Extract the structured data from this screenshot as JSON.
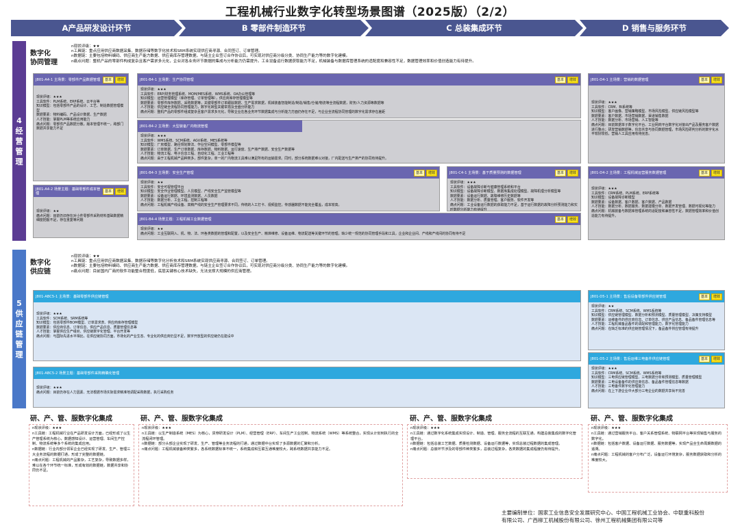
{
  "title": "工程机械行业数字化转型场景图谱（2025版）（2/2）",
  "stages": [
    "A产品研发设计环节",
    "B 零部件制造环节",
    "C 总装集成环节",
    "D 销售与服务环节"
  ],
  "colors": {
    "stage": "#4a5690",
    "management": "#5b3c93",
    "supply": "#4a78c8",
    "header_purple": "#6a66b0",
    "header_cyan": "#2ea8de",
    "card_gray": "#cfcfd3",
    "card_blue": "#dbe6f4",
    "tag_yellow": "#f7e01c"
  },
  "row1": {
    "sidebar": "4经营管理",
    "section_label_1": "数字化",
    "section_label_2": "协同管理",
    "lines": [
      "n现状评级：★★",
      "n工具链：重点应用供应商数据采集、数据存储等数字化技术和SRM系统实现供应商寻源、合同签订、订单管理。",
      "n数据链：主要包括物料编码、供应商生产能力数据、供应商库存管理数据，与链主企业签订合作协议后，可实现对供应商分级分类、协同生产能力等的数字化建模。",
      "n痛点问题：整机产品的零部件构成复杂且客户需求多元化，企业对各业务环节数据的集成与分析能力仍需提升。工业设备运行数据获取能力不足，机械装备与数据库管理系统的适配度和兼容性不足，数据管理效率和价值创造能力有待提升。"
    ],
    "cards": {
      "a1": {
        "head": "J801-A4-1 主场景：零部件产品数据管理",
        "tags": [
          "基本",
          "增效"
        ],
        "body": [
          "现状评级：★★★",
          "工具软件：PLM系统、ERP系统、云平台等",
          "知识模型：包括零部件产品的设计、工艺、制造数据管理模型",
          "数据要素：物料编码、产品设计数据、生产数据",
          "人才技能：掌握PLM等系统应用能力",
          "痛点问题：零部件产品数据分散，版本管理不统一，跨部门数据共享能力不足"
        ]
      },
      "a2": {
        "head": "J801-A4-2 场景主题：基础零部件成本管理",
        "tags": [
          "基本",
          "增效"
        ],
        "body": [
          "现状评级：★★",
          "痛点问题：目前仍旧存在对小件零部件采购材料基础数据精细度把握不足，存在重复等问题"
        ]
      },
      "b1": {
        "head": "J801-B4-1 主场景：生产协同管理",
        "tags": [
          "基本",
          "增效"
        ],
        "body": [
          "现状评级：★★★",
          "工具软件：ERP/财务管理系统、MOM/MES系统、WMS系统、OA办公管理等",
          "知识模型：运营管理模型（库存管理、订单管理等），供应商库存管理模型等",
          "数据要素：零部件库存数据、采购数据等，关键零部件订单跟踪数据、生产需求数据，机械装备智能制造/制造/销售/仓储/物流等全流程数据，财务/人力资源等数据等",
          "人才技能：供应链全流程协同管理能力，数字化转型关键举措及全面分析能力",
          "痛点问题：整机产品的零部件组成复杂且客户需求多元化，导致企业在各业务环节数据集成与分析能力方面仍存在不足，与企业全流程协同管理的数字化需求存在差距"
        ]
      },
      "b2": {
        "head": "J801-B4-2 主场景：大型装备厂内物流管理",
        "tags": [],
        "body": [
          "现状评级：★★★",
          "工具软件：WMS系统、SCM系统、AGV系统、MES系统等",
          "知识模型：厂房模型、路径规划算法、作业空间模型、零部件模型等",
          "数据要素：订单数据、生产订单数据、库存数据、物料数据、运行速度、生产排产数据、安全生产数据等",
          "人才技能：物流工程、电子信息工程、自动化工程、工业工程等",
          "痛点问题：由于工程机械产品种类多，部件复杂，单一的厂内物流工具难以满足所有的运输需求。同时，部分系统数据难以对接，厂内配送与生产排产的协同有待提升。"
        ]
      },
      "b3": {
        "head": "J801-B4-3 主场景：安全生产管理",
        "tags": [
          "基本",
          "增效"
        ],
        "body": [
          "现状评级：★★",
          "工具软件：安全可视管理平台",
          "知识模型：安全作业管理模型、人员模型、产线安全生产监管模型等",
          "数据要素：设备运行数据、环境监测数据、人员数据",
          "人才技能：数据分析、工业工程、控制工程等",
          "痛点问题：工程机械产线设备、高精产线的安全生产管理要求不同，传统的人工打卡、视频监控，传感器数据不能完全覆盖，成本较高。"
        ]
      },
      "b4": {
        "head": "J801-B4-4 场景主题：工程机械工业数据管理",
        "tags": [
          "基本",
          "增效"
        ],
        "body": [
          "现状评级：★★",
          "痛点问题：工业互联网入、机、物、法、环各类数据的管理和配置，以及安全生产、精准维修、设备运维、物流配送等关键环节的管理，缺少统一规范的协同管理手段和工具，企业和企业间、产线和产线间的协同有待不足"
        ]
      },
      "c1": {
        "head": "J801-C4-1 主场景：基于质量预测的数据管理",
        "tags": [
          "基本",
          "增效"
        ],
        "body": [
          "现状评级：★★★",
          "工具软件：设备故障诊断与健康管理系统和平台",
          "知识模型：设备故障诊断模型、数据库集成处理模型、故障机理分析模型等",
          "数据要素：设备运行数据、故障维修历史数据等",
          "人才技能：数据分析、质量管理、客户服务、软件开发等",
          "痛点问题：工业设备运行数据的获取能力不足，基于运行数据的故障分析预测能力和实时数据分析能力有待提升"
        ]
      },
      "d1": {
        "head": "J801-D4-1 主场景：营销的数据管理",
        "tags": [
          "基本",
          "增效"
        ],
        "body": [
          "现状评级：★★★",
          "工具软件：CRM、BI系统等",
          "知识模型：客户画像、营销策略模型、市场风险模型、供应链风险模型等",
          "数据要素：客户数据、市场营销数据、渠道销售数据",
          "人才技能：数据分析、市场营销、人工智能等",
          "痛点问题：目前数据单子数字化平台、工业网商平台数字化对接出产品及服务客户数据进行整合；研发营销数据等，信息共享与协同数据管理，市场风险研判分析的数字化水平较好较低，营销人工具应用有待完善。"
        ]
      },
      "d2": {
        "head": "J801-D4-2 主场景：工程机械运营服务数据管理",
        "tags": [
          "基本",
          "增效"
        ],
        "body": [
          "现状评级：★★★",
          "工具软件：CRM系统、PLM系统、ERP系统等",
          "知识模型：设备故障诊断模型",
          "数据要素：设备数据、客户数据、客户数据、产品数据",
          "人才技能：数据分析、数据服务、数据建模分析、数据开发管理、数据可视化等能力",
          "痛点问题：机械装备与数据库管理系统的适配度和兼容性不足，数据管理效率和价值创造能力有待提升。"
        ]
      }
    }
  },
  "row2": {
    "sidebar": "5供应链管理",
    "section_label_1": "数字化",
    "section_label_2": "供应链",
    "lines": [
      "n现状评级：★★",
      "n工具链：重点应用供应商数据采集、数据存储等数字化分析技术和SRM系统实现供应商寻源、合同签订、订单管理。",
      "n数据链：主要包括物料编码、供应商生产能力数据、供应商库存管理数据，与链主企业签订合作协议后，可实现对供应商分级分类、协同生产能力等的数字化建模。",
      "n痛点问题：目前国内厂商的软件功能整合程度低，底层关键核心技术缺失，无法支撑大规模的供应商管理。"
    ],
    "cards": {
      "abc1": {
        "head": "J801-ABC5-1 主场景：基础零部件供应链管理",
        "tags": [],
        "body": [
          "现状评级：★★★",
          "工具软件：SCM系统、SRM系统等",
          "知识模型：包括零部件BOM模型、订单需求表、供应商库存管理模型",
          "数据要素：供应商信息、订单信息、供应产品信息、质量管理信息等",
          "人才技能：掌握供应生产组织、供应链数字化管理、平台开发等",
          "痛点问题：与国际先进水平相比，在供应链协同方面，市场化的产业生态、专业化的供应商仍显不足，数字开放型的供应链仍在建设中"
        ]
      },
      "abc2": {
        "head": "J801-ABC5-2 场景主题：基础零部件采购精确化管理",
        "tags": [],
        "body": [
          "现状评级：★★★",
          "痛点问题：目前仍存在人力因素、无法根据市场实际需求精准地调配采购数据，执行采购任务"
        ]
      },
      "d1": {
        "head": "J801-D5-1 主场景：售后设备零部件供应链管理",
        "tags": [
          "基本",
          "增效"
        ],
        "body": [
          "现状评级：★★",
          "工具软件：CRM系统、SCM系统、WMS系统等",
          "知识模型：供应链管理模型、数据分析和预测模型、质量管理模型、决策支持模型",
          "数据要素：运维备件的供应商信息、订单信息、供应产品信息、备品备件管理信息等",
          "人才技能：工程机械备品备件的调配和管理能力，数字化管理能力",
          "痛点问题：在缺乏标准的供应链管理情况下，备品备件供应管理有待提升"
        ]
      },
      "d2": {
        "head": "J801-D5-2 主场景：售后运维三电备件供应链管理",
        "tags": [
          "基本",
          "增效"
        ],
        "body": [
          "现状评级：★★★",
          "工具软件：CRM系统、SCM系统、WMS系统等",
          "知识模型：三电供应链管理模型、三电数据分析和预测模型、质量管理模型",
          "数据要素：三电设备备件的供应商信息、备品备件管理信息等数据",
          "人才技能：三电备件数字化管理能力",
          "痛点问题：在上下游企业中大部分三电企业的数据共享尚不完善"
        ]
      }
    }
  },
  "bottom": {
    "a": {
      "title": "研、产、管、服数字化集成",
      "text": [
        "n现状评级：★★★",
        "n工具链：工程机械行业在产品研发设计方面，已经形成了以生产管理系统为核心，数据感知设计、运营管理、车间生产控制、物流系统等多个系统的集成应用。",
        "n数据链：行业内部分领军企业已经实现了研发、生产、管理三大业务流程的数据打通，形成了完整的数据链。",
        "n痛点问题：工程机械的产品繁杂，工艺复杂，导致数据多样，难以在各个环节统一标准，形成有效的数据链，数据共享和协同仍不足。"
      ]
    },
    "b": {
      "title": "研、产、管、服数字化集成",
      "text": [
        "n现状评级：★★★",
        "n工具链：以生产制造系统（MES）为核心，贯穿研发设计（PLM）、经营管理（ERP）、车间生产工业控制、物流系统（WMS）等系统整合，实现从计划到执行的全流程闭环管理。",
        "n数据链：部分头部企业实现了研发、生产、管理等业务流程的打通，通过数据中台实现了多源数据的汇聚和分析。",
        "n痛点问题：工程机械装备种类繁多，各系统数据标准不统一，系统集成和互联互通难度较大，跨系统数据共享能力不足。"
      ]
    },
    "c": {
      "title": "研、产、管、服数字化集成",
      "text": [
        "n现状评级：★★★",
        "n工具链：通过数字化系统集成实现设计、制造、管理、服务全流程的互联互通，构建总装集成的数字化管理平台。",
        "n数据链：包括总装工艺数据、质量检测数据、设备运行数据等，实现总装过程数据的集成管理。",
        "n痛点问题：总装环节涉及的零部件种类繁多，总装过程复杂，各类数据的集成程度仍有待提升。"
      ]
    },
    "d": {
      "title": "研、产、管、服数字化集成",
      "text": [
        "n现状评级：★★★",
        "n工具链：通过营销服务平台、客户关系管理系统、物联网平台等实现销售与服务的数字化。",
        "n数据链：包括客户数据、设备运行数据、服务数据等，实现产品全生命周期数据的追溯。",
        "n痛点问题：工程机械的客户分布广泛，设备运行环境复杂，服务数据获取和分析的难度较大。"
      ]
    }
  },
  "footer": {
    "line1": "主要编制单位：国家工业信息安全发展研究中心、中国工程机械工业协会、中联重科股份",
    "line2": "有限公司、广西柳工机械股份有限公司、徐州工程机械集团有限公司等"
  }
}
